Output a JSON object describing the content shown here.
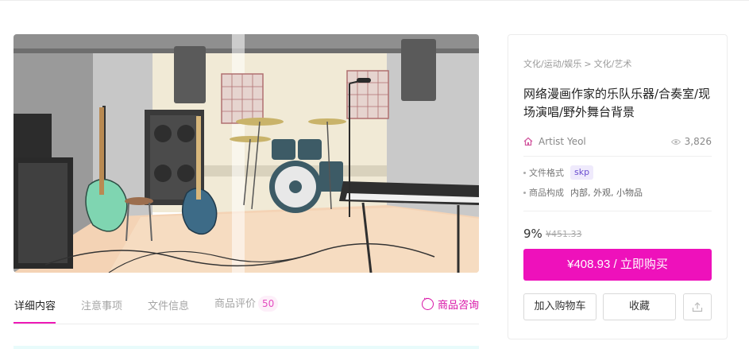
{
  "hero": {
    "alt": ""
  },
  "tabs": [
    {
      "label": "详细内容"
    },
    {
      "label": "注意事项"
    },
    {
      "label": "文件信息"
    },
    {
      "label": "商品评价"
    }
  ],
  "review_count": "50",
  "consult_label": "商品咨询",
  "product": {
    "breadcrumb": [
      "文化/运动/娱乐",
      ">",
      "文化/艺术"
    ],
    "title": "网络漫画作家的乐队乐器/合奏室/现场演唱/野外舞台背景",
    "author": "Artist Yeol",
    "views": "3,826",
    "specs": {
      "format_label": "文件格式",
      "format_value": "skp",
      "composition_label": "商品构成",
      "composition_value": "内部, 外观, 小物品"
    },
    "discount": "9%",
    "original_price": "¥451.33",
    "buy_label": "¥408.93 / 立即购买",
    "cart_label": "加入购物车",
    "favorite_label": "收藏"
  },
  "colors": {
    "accent": "#ee11bb",
    "tab_active_underline": "#ee19b6",
    "format_badge_bg": "#efeafc"
  },
  "icons": [
    "house-icon",
    "eye-icon",
    "chat-bubble-icon",
    "share-icon"
  ]
}
